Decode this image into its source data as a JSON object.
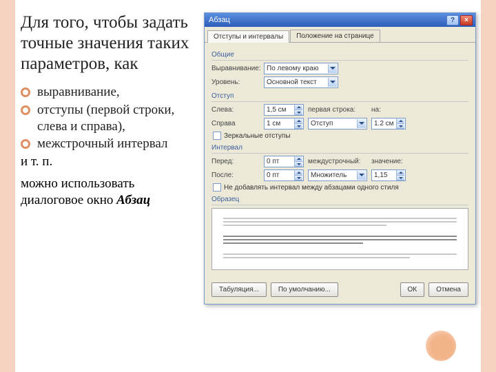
{
  "slide": {
    "title": "Для того, чтобы задать точные значения таких параметров, как",
    "bullets": [
      "выравнивание,",
      "отступы (первой строки, слева и справа),",
      "межстрочный интервал"
    ],
    "tail": "и т. п.",
    "p2_a": "можно использовать диалоговое окно ",
    "p2_b": "Абзац"
  },
  "dialog": {
    "title": "Абзац",
    "help": "?",
    "close": "×",
    "tabs": {
      "indents": "Отступы и интервалы",
      "position": "Положение на странице"
    },
    "sections": {
      "general": "Общие",
      "indent": "Отступ",
      "interval": "Интервал",
      "preview": "Образец"
    },
    "general": {
      "align_label": "Выравнивание:",
      "align_value": "По левому краю",
      "level_label": "Уровень:",
      "level_value": "Основной текст"
    },
    "indent": {
      "left_label": "Слева:",
      "left_value": "1,5 см",
      "right_label": "Справа",
      "right_value": "1 см",
      "first_label": "первая строка:",
      "first_value": "Отступ",
      "by_label": "на:",
      "by_value": "1.2 см",
      "mirror": "Зеркальные отступы"
    },
    "interval": {
      "before_label": "Перед:",
      "before_value": "0 пт",
      "after_label": "После:",
      "after_value": "0 пт",
      "line_label": "междустрочный:",
      "line_value": "Множитель",
      "val_label": "значение:",
      "val_value": "1,15",
      "noadd": "Не добавлять интервал между абзацами одного стиля"
    },
    "buttons": {
      "tabstops": "Табуляция...",
      "default": "По умолчанию...",
      "ok": "ОК",
      "cancel": "Отмена"
    }
  }
}
